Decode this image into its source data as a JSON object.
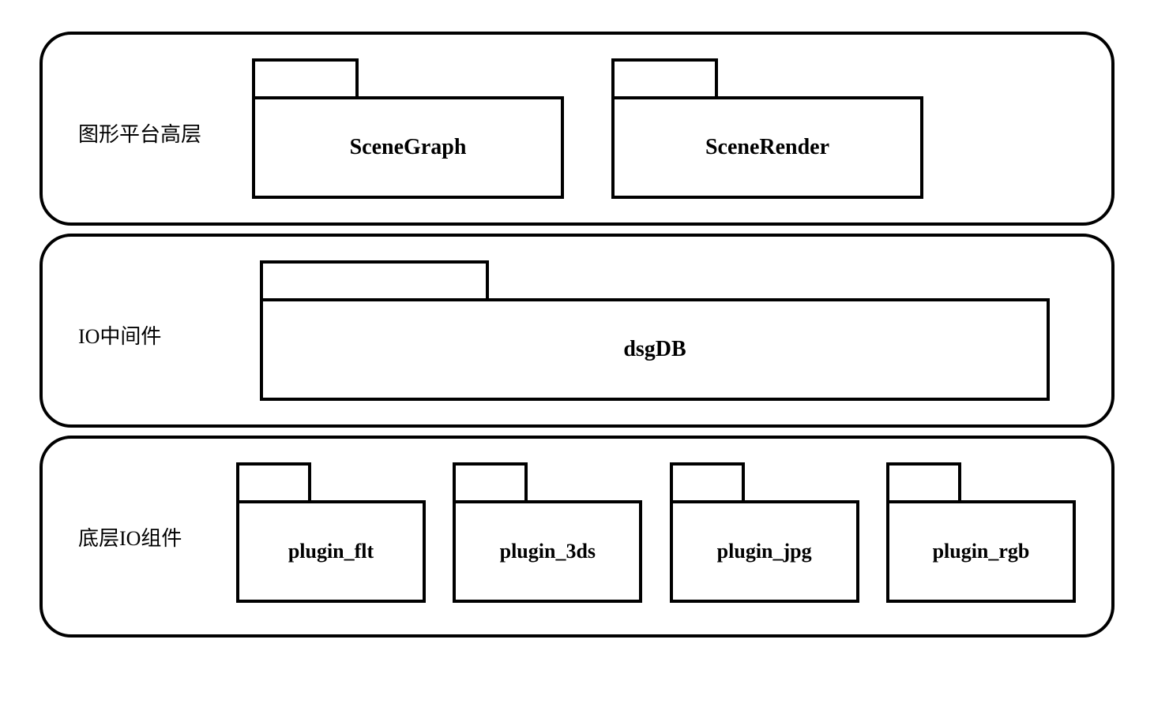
{
  "layers": {
    "top": {
      "label": "图形平台高层",
      "packages": {
        "scenegraph": "SceneGraph",
        "scenerender": "SceneRender"
      }
    },
    "middle": {
      "label": "IO中间件",
      "packages": {
        "dsgdb": "dsgDB"
      }
    },
    "bottom": {
      "label": "底层IO组件",
      "packages": {
        "plugin_flt": "plugin_flt",
        "plugin_3ds": "plugin_3ds",
        "plugin_jpg": "plugin_jpg",
        "plugin_rgb": "plugin_rgb"
      }
    }
  }
}
